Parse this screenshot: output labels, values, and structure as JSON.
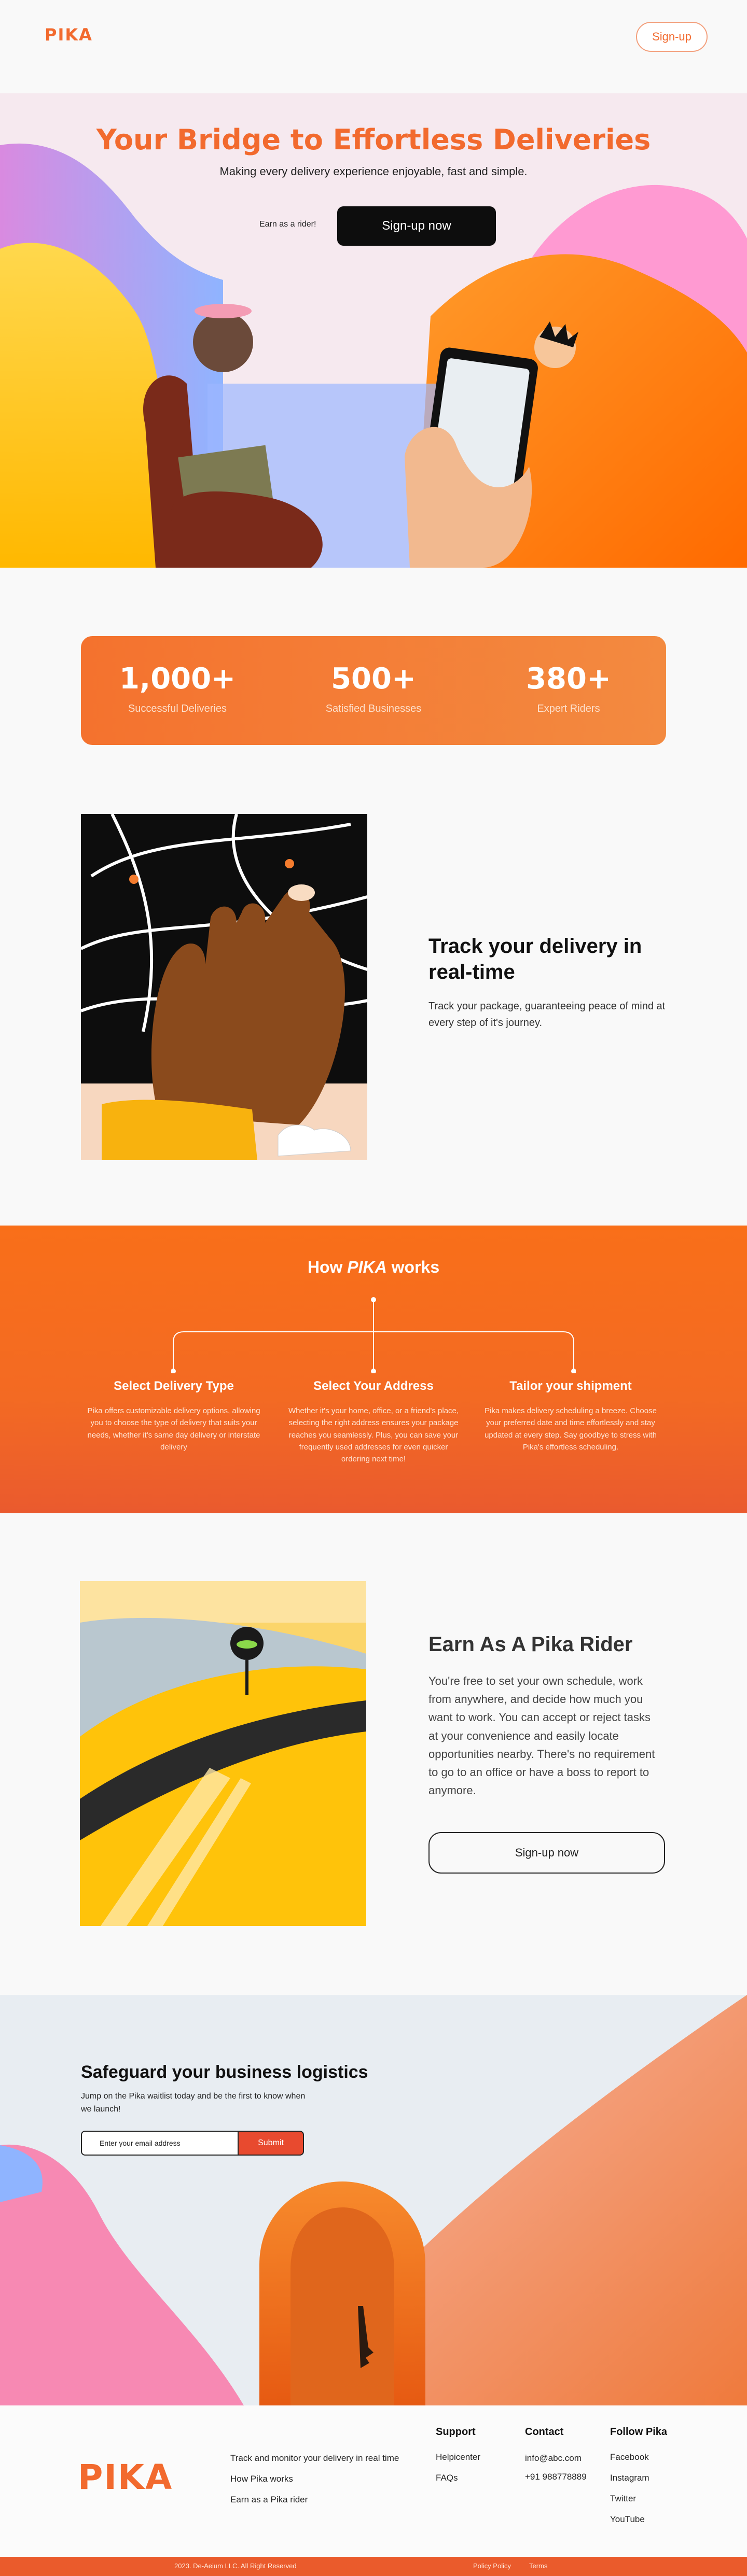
{
  "header": {
    "logo": "PIKA",
    "signup": "Sign-up"
  },
  "hero": {
    "title": "Your Bridge to Effortless Deliveries",
    "subtitle": "Making every delivery experience enjoyable, fast and simple.",
    "earn_link": "Earn as a rider!",
    "cta": "Sign-up now"
  },
  "stats": [
    {
      "value": "1,000+",
      "label": "Successful Deliveries"
    },
    {
      "value": "500+",
      "label": "Satisfied Businesses"
    },
    {
      "value": "380+",
      "label": "Expert Riders"
    }
  ],
  "track": {
    "title": "Track your delivery in real-time",
    "description": "Track your package, guaranteeing peace of mind at every step of it's journey."
  },
  "how": {
    "title_prefix": "How ",
    "title_brand": "PIKA",
    "title_suffix": " works",
    "steps": [
      {
        "title": "Select Delivery Type",
        "text": "Pika offers customizable delivery options, allowing you to choose the type of delivery that suits your needs, whether it's same day delivery or interstate delivery"
      },
      {
        "title": "Select Your Address",
        "text": "Whether it's your home, office, or a friend's place, selecting the right address ensures your package reaches you seamlessly. Plus, you can save your frequently used addresses for even quicker ordering next time!"
      },
      {
        "title": "Tailor your shipment",
        "text": "Pika makes delivery scheduling a breeze. Choose your preferred date and time effortlessly and stay updated at every step. Say goodbye to stress with Pika's effortless scheduling."
      }
    ]
  },
  "earn": {
    "title": "Earn As A Pika Rider",
    "description": "You're free to set your own schedule, work from anywhere, and decide how much you want to work. You can accept or reject tasks at your convenience and easily locate opportunities nearby. There's no requirement to go to an office or have a boss to report to anymore.",
    "cta": "Sign-up  now"
  },
  "safeguard": {
    "title": "Safeguard your business logistics",
    "subtitle": "Jump on the Pika waitlist today and be the first to know when we launch!",
    "input_placeholder": "Enter your email address",
    "submit": "Submit"
  },
  "footer": {
    "logo": "PIKA",
    "links": [
      "Track and monitor your delivery in real time",
      "How Pika works",
      "Earn as a Pika rider"
    ],
    "support": {
      "heading": "Support",
      "items": [
        "Helpicenter",
        "FAQs"
      ]
    },
    "contact": {
      "heading": "Contact",
      "items": [
        "info@abc.com",
        "+91 988778889"
      ]
    },
    "follow": {
      "heading": "Follow Pika",
      "items": [
        "Facebook",
        "Instagram",
        "Twitter",
        "YouTube"
      ]
    },
    "copyright": "2023. De-Aeium LLC. All Right Reserved",
    "policy": "Policy Policy",
    "terms": "Terms"
  },
  "colors": {
    "brand": "#f26a2e",
    "dark": "#0d0d0d",
    "submit": "#e84a2f"
  }
}
